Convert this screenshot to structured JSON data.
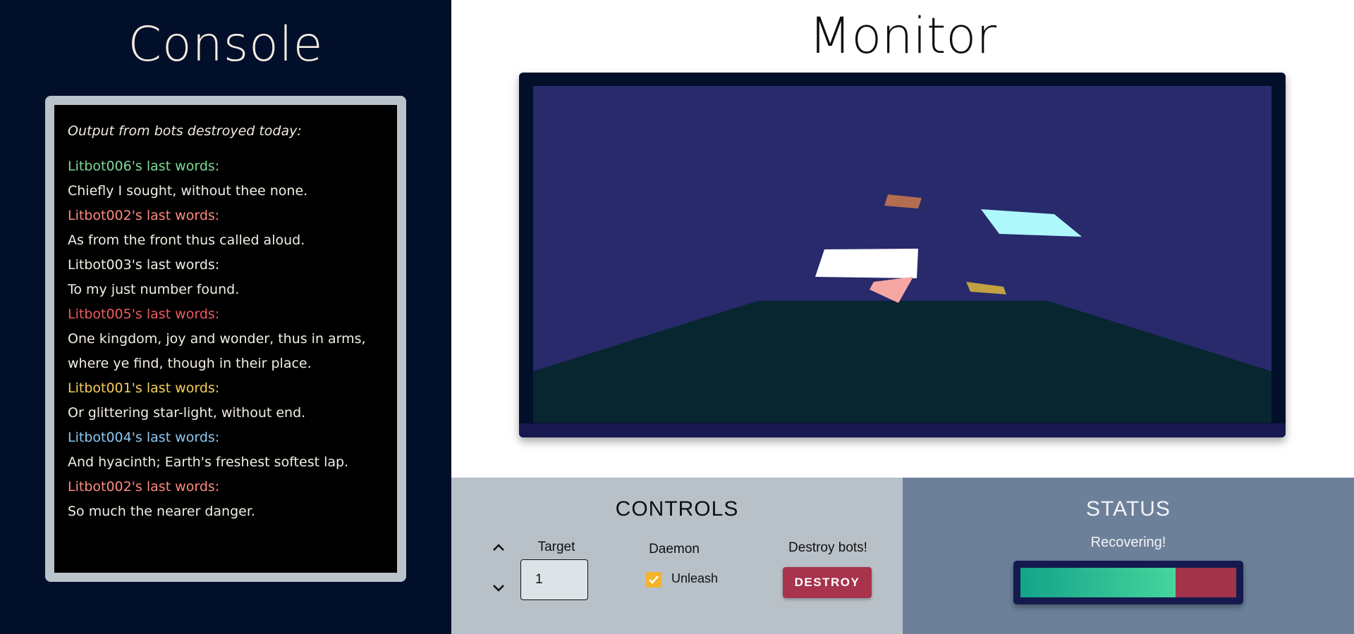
{
  "console": {
    "title": "Console",
    "intro": "Output from bots destroyed today:",
    "lines": [
      {
        "text": "Litbot006's last words:",
        "color": "#7ddc96"
      },
      {
        "text": "Chiefly I sought, without thee none.",
        "color": "#f2eee4"
      },
      {
        "text": "Litbot002's last words:",
        "color": "#ff8a7f"
      },
      {
        "text": "As from the front thus called aloud.",
        "color": "#f2eee4"
      },
      {
        "text": "Litbot003's last words:",
        "color": "#f2eee4"
      },
      {
        "text": "To my just number found.",
        "color": "#f2eee4"
      },
      {
        "text": "Litbot005's last words:",
        "color": "#ef5b62"
      },
      {
        "text": "One kingdom, joy and wonder, thus in arms,",
        "color": "#f2eee4"
      },
      {
        "text": "where ye find, though in their place.",
        "color": "#f2eee4"
      },
      {
        "text": "Litbot001's last words:",
        "color": "#f6cf5a"
      },
      {
        "text": "Or glittering star-light, without end.",
        "color": "#f2eee4"
      },
      {
        "text": "Litbot004's last words:",
        "color": "#8cc9f3"
      },
      {
        "text": "And hyacinth; Earth's freshest softest lap.",
        "color": "#f2eee4"
      },
      {
        "text": "Litbot002's last words:",
        "color": "#ff8a7f"
      },
      {
        "text": "So much the nearer danger.",
        "color": "#f2eee4"
      }
    ]
  },
  "monitor": {
    "title": "Monitor",
    "colors": {
      "sky": "#282a6c",
      "ground": "#07262f",
      "frame": "#020f2b"
    }
  },
  "controls": {
    "title": "CONTROLS",
    "target_label": "Target",
    "target_value": "1",
    "up_icon": "chevron-up-icon",
    "down_icon": "chevron-down-icon",
    "daemon_label": "Daemon",
    "unleash_label": "Unleash",
    "unleash_checked": true,
    "destroy_label": "Destroy bots!",
    "destroy_button": "DESTROY"
  },
  "status": {
    "title": "STATUS",
    "text": "Recovering!",
    "progress": 0.72,
    "colors": {
      "fill_start": "#13a38a",
      "fill_end": "#46d59c",
      "remaining": "#a2334a"
    }
  }
}
